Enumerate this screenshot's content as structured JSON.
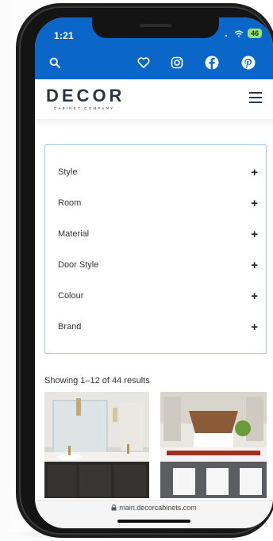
{
  "status": {
    "time": "1:21",
    "battery": "46"
  },
  "logo": {
    "main": "DECOR",
    "sub": "CABINET COMPANY"
  },
  "filters": [
    {
      "label": "Style",
      "toggle": "+"
    },
    {
      "label": "Room",
      "toggle": "+"
    },
    {
      "label": "Material",
      "toggle": "+"
    },
    {
      "label": "Door Style",
      "toggle": "+"
    },
    {
      "label": "Colour",
      "toggle": "+"
    },
    {
      "label": "Brand",
      "toggle": "+"
    }
  ],
  "results_text": "Showing 1–12 of 44 results",
  "url": "main.decorcabinets.com",
  "icons": [
    "search-icon",
    "heart-icon",
    "instagram-icon",
    "facebook-icon",
    "pinterest-icon",
    "hamburger-menu-icon",
    "lock-icon"
  ],
  "colors": {
    "brand_blue": "#0a66c9",
    "filter_border": "#a7c7e6",
    "logo_text": "#2a3642"
  }
}
